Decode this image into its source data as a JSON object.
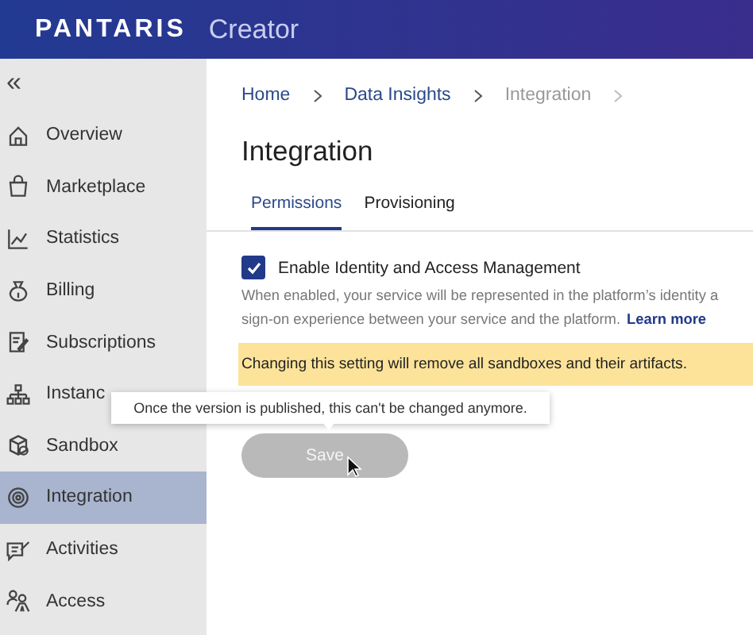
{
  "header": {
    "brand": "PANTARIS",
    "product": "Creator"
  },
  "sidebar": {
    "collapse": "«",
    "items": [
      {
        "label": "Overview",
        "selected": false
      },
      {
        "label": "Marketplace",
        "selected": false
      },
      {
        "label": "Statistics",
        "selected": false
      },
      {
        "label": "Billing",
        "selected": false
      },
      {
        "label": "Subscriptions",
        "selected": false
      },
      {
        "label": "Instanc",
        "selected": false
      },
      {
        "label": "Sandbox",
        "selected": false
      },
      {
        "label": "Integration",
        "selected": true
      },
      {
        "label": "Activities",
        "selected": false
      },
      {
        "label": "Access",
        "selected": false
      }
    ]
  },
  "breadcrumb": [
    {
      "label": "Home",
      "current": false
    },
    {
      "label": "Data Insights",
      "current": false
    },
    {
      "label": "Integration",
      "current": true
    }
  ],
  "title": "Integration",
  "tabs": [
    {
      "label": "Permissions",
      "selected": true
    },
    {
      "label": "Provisioning",
      "selected": false
    }
  ],
  "setting": {
    "label": "Enable Identity and Access Management",
    "checked": true,
    "description_line1": "When enabled, your service will be represented in the platform’s identity a",
    "description_line2": "sign-on experience between your service and the platform.",
    "link": "Learn more"
  },
  "warning": "Changing this setting will remove all sandboxes and their artifacts.",
  "tooltip": "Once the version is published, this can't be changed anymore.",
  "save": {
    "label": "Save",
    "disabled": true
  }
}
